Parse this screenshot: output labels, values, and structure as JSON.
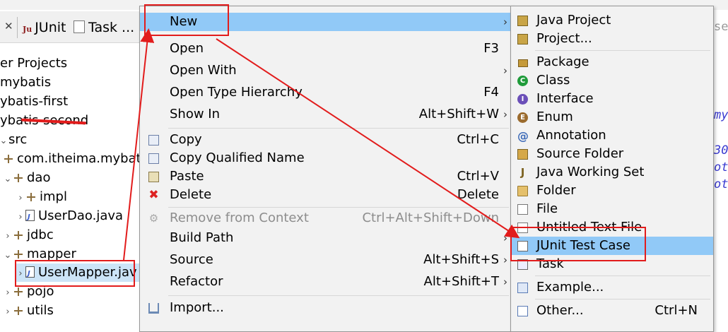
{
  "tabs": [
    {
      "label": "JUnit",
      "icon": "junit-icon"
    },
    {
      "label": "Task ...",
      "icon": "task-icon"
    }
  ],
  "tree": [
    {
      "label": "er Projects",
      "indent": 0,
      "kind": "text"
    },
    {
      "label": "mybatis",
      "indent": 0,
      "kind": "text"
    },
    {
      "label": "ybatis-first",
      "indent": 0,
      "kind": "text"
    },
    {
      "label": "ybatis-second",
      "indent": 0,
      "kind": "text"
    },
    {
      "label": "src",
      "indent": 1,
      "kind": "text"
    },
    {
      "label": "com.itheima.mybati",
      "indent": 1,
      "kind": "pkg"
    },
    {
      "label": "dao",
      "indent": 1,
      "kind": "pkg"
    },
    {
      "label": "impl",
      "indent": 2,
      "kind": "pkg"
    },
    {
      "label": "UserDao.java",
      "indent": 2,
      "kind": "java"
    },
    {
      "label": "jdbc",
      "indent": 1,
      "kind": "pkg"
    },
    {
      "label": "mapper",
      "indent": 1,
      "kind": "pkg"
    },
    {
      "label": "UserMapper.jav",
      "indent": 2,
      "kind": "java"
    },
    {
      "label": "pojo",
      "indent": 1,
      "kind": "pkg"
    },
    {
      "label": "utils",
      "indent": 1,
      "kind": "pkg"
    }
  ],
  "editor_fragments": [
    "se",
    "my",
    "30",
    "ot",
    "ot"
  ],
  "menu": {
    "new": "New",
    "open": "Open",
    "open_acc": "F3",
    "open_with": "Open With",
    "open_type_hierarchy": "Open Type Hierarchy",
    "open_type_hierarchy_acc": "F4",
    "show_in": "Show In",
    "show_in_acc": "Alt+Shift+W",
    "copy": "Copy",
    "copy_acc": "Ctrl+C",
    "copy_qualified": "Copy Qualified Name",
    "paste": "Paste",
    "paste_acc": "Ctrl+V",
    "delete": "Delete",
    "delete_acc": "Delete",
    "remove_from_context": "Remove from Context",
    "remove_acc": "Ctrl+Alt+Shift+Down",
    "build_path": "Build Path",
    "source": "Source",
    "source_acc": "Alt+Shift+S",
    "refactor": "Refactor",
    "refactor_acc": "Alt+Shift+T",
    "import": "Import..."
  },
  "submenu": {
    "java_project": "Java Project",
    "project": "Project...",
    "package": "Package",
    "class": "Class",
    "interface": "Interface",
    "enum": "Enum",
    "annotation": "Annotation",
    "source_folder": "Source Folder",
    "java_working_set": "Java Working Set",
    "folder": "Folder",
    "file": "File",
    "untitled_text_file": "Untitled Text File",
    "junit_test_case": "JUnit Test Case",
    "task": "Task",
    "example": "Example...",
    "other": "Other...",
    "other_acc": "Ctrl+N"
  },
  "icon_glyphs": {
    "class": "C",
    "interface": "I",
    "enum": "E",
    "annotation": "@",
    "delete": "✖",
    "junit": "Ju",
    "close": "✕"
  },
  "colors": {
    "highlight": "#91c9f7",
    "annotation_red": "#e21c1c",
    "menu_bg": "#f2f2f2"
  }
}
